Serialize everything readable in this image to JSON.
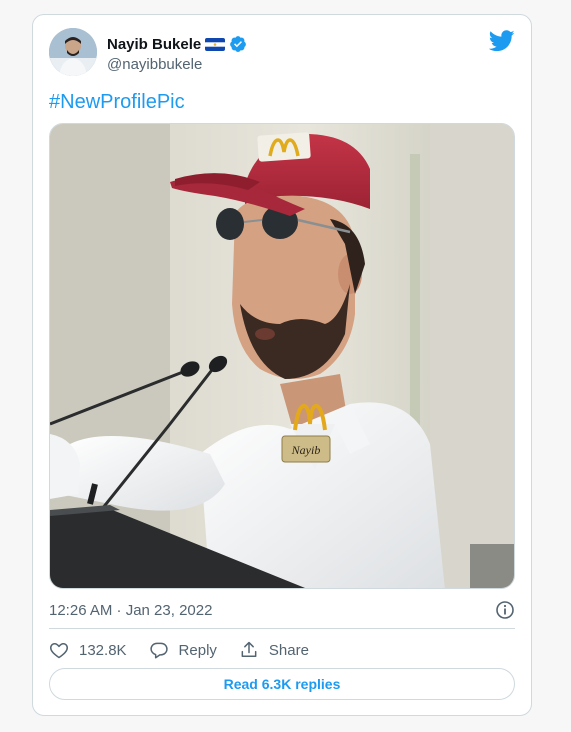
{
  "author": {
    "name": "Nayib Bukele",
    "handle": "@nayibbukele",
    "flag_icon": "el-salvador-flag-icon",
    "verified_icon": "verified-badge-icon"
  },
  "tweet": {
    "text": "#NewProfilePic",
    "timestamp": "12:26 AM · Jan 23, 2022",
    "nametag": "Nayib"
  },
  "actions": {
    "likes": "132.8K",
    "reply_label": "Reply",
    "share_label": "Share"
  },
  "read_replies": "Read 6.3K replies",
  "colors": {
    "accent": "#1d9bf0",
    "cap": "#b02a3c",
    "text_secondary": "#536471"
  }
}
